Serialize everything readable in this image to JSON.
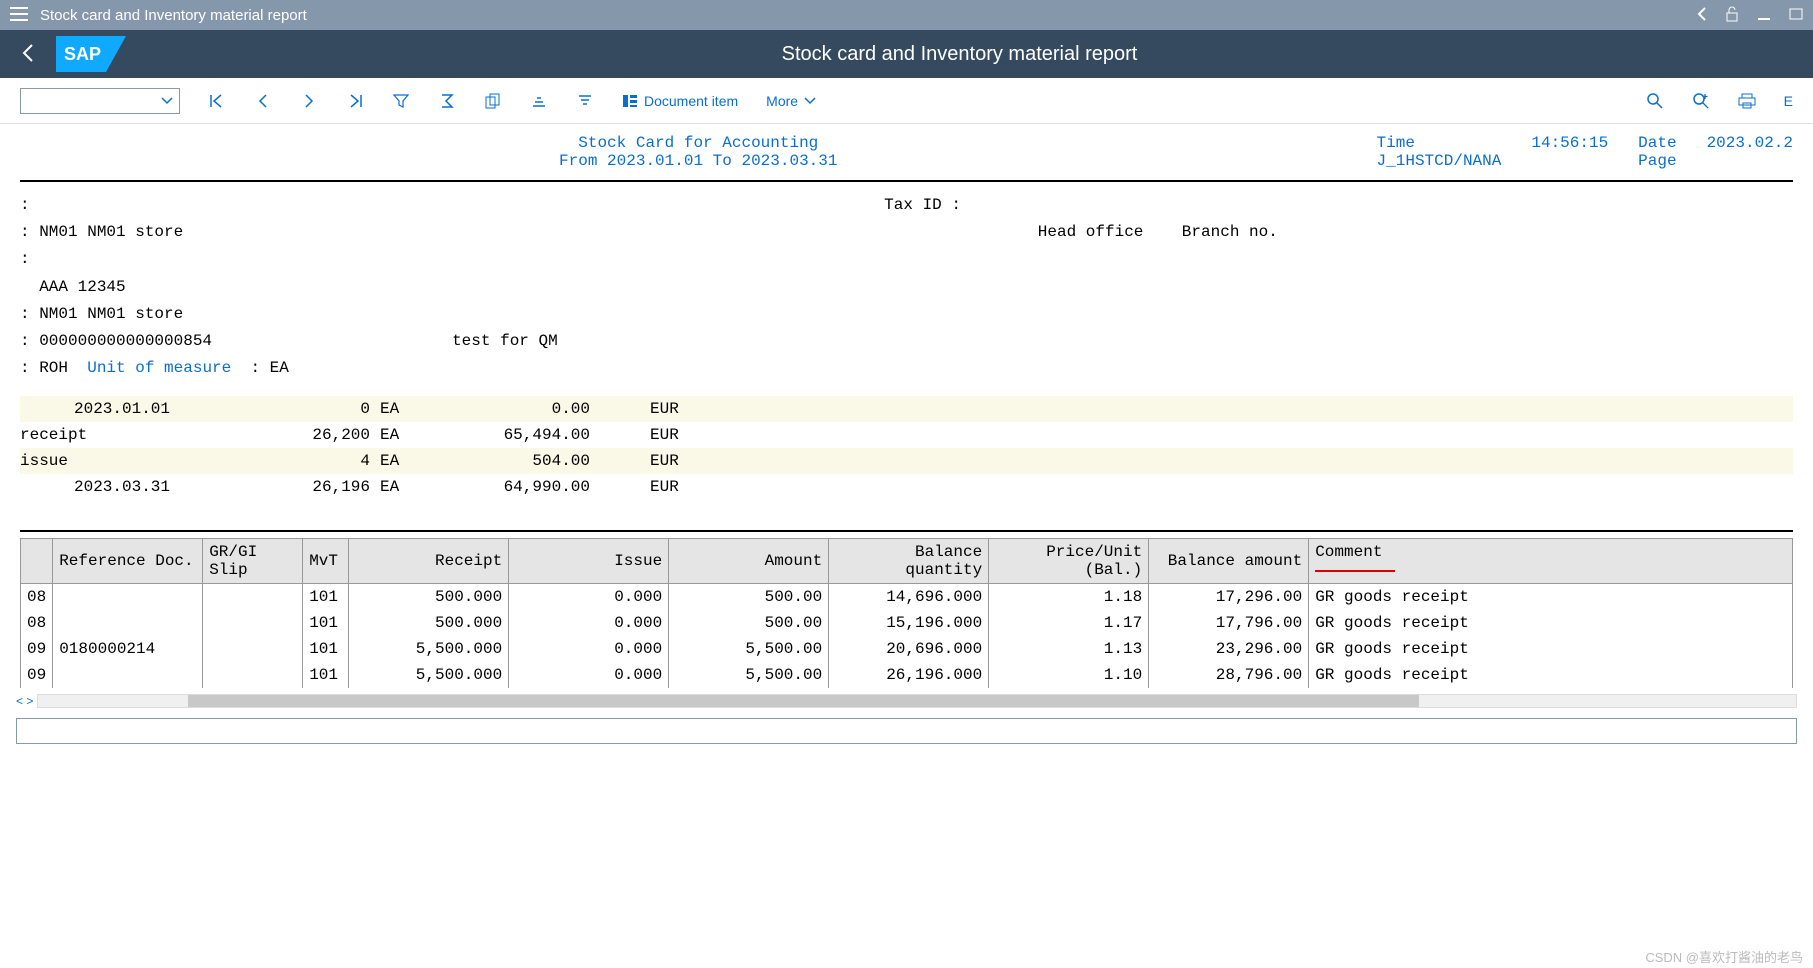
{
  "titlebar": {
    "title": "Stock card and Inventory material report"
  },
  "header": {
    "title": "Stock card and Inventory material report"
  },
  "toolbar": {
    "docitem": "Document item",
    "more": "More",
    "export": "E"
  },
  "report": {
    "title": "Stock Card for Accounting",
    "range": "From 2023.01.01 To 2023.03.31",
    "time_label": "Time",
    "time_value": "14:56:15",
    "date_label": "Date",
    "date_value": "2023.02.2",
    "sys_label": "J_1HSTCD/NANA",
    "page_label": "Page"
  },
  "info": {
    "l1": ":",
    "l2": ": NM01 NM01 store",
    "taxid": "Tax ID :",
    "headoffice": "Head office    Branch no.",
    "l3": ":",
    "aaa": "  AAA 12345",
    "l4": ": NM01 NM01 store",
    "l5_a": ": 000000000000000854",
    "l5_b": "test for QM",
    "l6_a": ": ROH  ",
    "uom_label": "Unit of measure",
    "l6_c": "  : EA"
  },
  "summary": {
    "r0_date": "2023.01.01",
    "r0_qty": "0",
    "r0_uom": "EA",
    "r0_amt": "0.00",
    "r0_cur": "EUR",
    "r1_lbl": "receipt",
    "r1_qty": "26,200",
    "r1_uom": "EA",
    "r1_amt": "65,494.00",
    "r1_cur": "EUR",
    "r2_lbl": "issue",
    "r2_qty": "4",
    "r2_uom": "EA",
    "r2_amt": "504.00",
    "r2_cur": "EUR",
    "r3_date": "2023.03.31",
    "r3_qty": "26,196",
    "r3_uom": "EA",
    "r3_amt": "64,990.00",
    "r3_cur": "EUR"
  },
  "cols": {
    "c0": "",
    "c1": "Reference Doc.",
    "c2": "GR/GI Slip",
    "c3": "MvT",
    "c4": "Receipt",
    "c5": "Issue",
    "c6": "Amount",
    "c7": "Balance quantity",
    "c8": "Price/Unit (Bal.)",
    "c9": "Balance amount",
    "c10": "Comment"
  },
  "rows": [
    {
      "c0": "08",
      "c1": "",
      "c3": "101",
      "c4": "500.000",
      "c5": "0.000",
      "c6": "500.00",
      "c7": "14,696.000",
      "c8": "1.18",
      "c9": "17,296.00",
      "c10": "GR goods receipt"
    },
    {
      "c0": "08",
      "c1": "",
      "c3": "101",
      "c4": "500.000",
      "c5": "0.000",
      "c6": "500.00",
      "c7": "15,196.000",
      "c8": "1.17",
      "c9": "17,796.00",
      "c10": "GR goods receipt"
    },
    {
      "c0": "09",
      "c1": "0180000214",
      "c3": "101",
      "c4": "5,500.000",
      "c5": "0.000",
      "c6": "5,500.00",
      "c7": "20,696.000",
      "c8": "1.13",
      "c9": "23,296.00",
      "c10": "GR goods receipt"
    },
    {
      "c0": "09",
      "c1": "",
      "c3": "101",
      "c4": "5,500.000",
      "c5": "0.000",
      "c6": "5,500.00",
      "c7": "26,196.000",
      "c8": "1.10",
      "c9": "28,796.00",
      "c10": "GR goods receipt"
    }
  ],
  "watermark": "CSDN @喜欢打酱油的老鸟"
}
